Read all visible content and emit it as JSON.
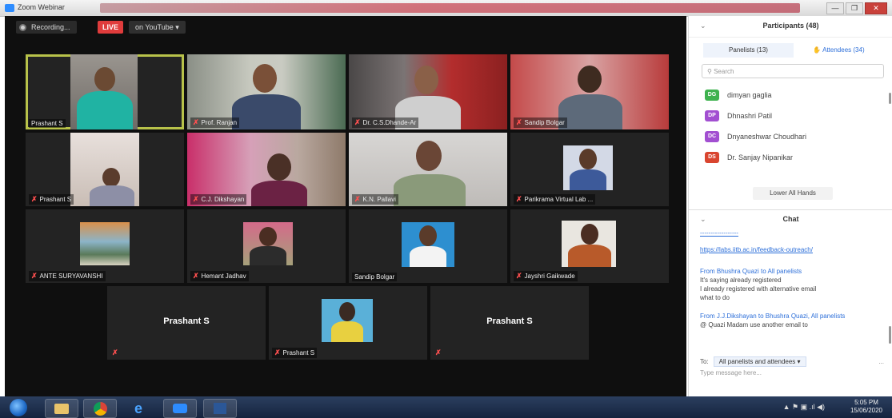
{
  "window": {
    "title": "Zoom Webinar",
    "controls": [
      "—",
      "❐",
      "✕"
    ]
  },
  "toolbar": {
    "recording": "Recording...",
    "live": "LIVE",
    "on_youtube": "on YouTube ▾"
  },
  "tiles": [
    {
      "name": "Prashant S",
      "mic_muted": false,
      "active": true
    },
    {
      "name": "Prof. Ranjan",
      "mic_muted": true
    },
    {
      "name": "Dr. C.S.Dhande-Ar",
      "mic_muted": true
    },
    {
      "name": "Sandip Bolgar",
      "mic_muted": true
    },
    {
      "name": "Prashant S",
      "mic_muted": true
    },
    {
      "name": "C.J. Dikshayan",
      "mic_muted": true
    },
    {
      "name": "K.N. Pallavi",
      "mic_muted": true
    },
    {
      "name": "Parikrama Virtual Lab ...",
      "mic_muted": true
    },
    {
      "name": "ANTE SURYAVANSHI",
      "mic_muted": true
    },
    {
      "name": "Hemant Jadhav",
      "mic_muted": true
    },
    {
      "name": "Sandip Bolgar",
      "mic_muted": false
    },
    {
      "name": "Jayshri Gaikwade",
      "mic_muted": true
    },
    {
      "name": "Prashant S",
      "mic_muted": true
    },
    {
      "name": "Prashant S",
      "mic_muted": true
    },
    {
      "name": "Prashant S",
      "mic_muted": true
    }
  ],
  "participants": {
    "title": "Participants (48)",
    "tab_panelists": "Panelists (13)",
    "tab_attendees": "Attendees (34)",
    "search_placeholder": "Search",
    "list": [
      {
        "initials": "DG",
        "name": "dimyan gaglia",
        "color": "#3fb24f"
      },
      {
        "initials": "DP",
        "name": "Dhnashri Patil",
        "color": "#a24fd1"
      },
      {
        "initials": "DC",
        "name": "Dnyaneshwar Choudhari",
        "color": "#a24fd1"
      },
      {
        "initials": "DS",
        "name": "Dr. Sanjay Nipanikar",
        "color": "#d9452f"
      }
    ],
    "lower_all_hands": "Lower All Hands"
  },
  "chat": {
    "title": "Chat",
    "link_partial": "------------------",
    "link": "https://labs.iitb.ac.in/feedback-outreach/",
    "msg1_from": "From Bhushra Quazi to All panelists",
    "msg1_lines": [
      "It's saying already registered",
      "I already registered with alternative email",
      "what to do"
    ],
    "msg2_from": "From J.J.Dikshayan to Bhushra Quazi, All panelists",
    "msg2_lines": [
      "@ Quazi Madam use another email to"
    ],
    "to_label": "To:",
    "to_value": "All panelists and attendees ▾",
    "more": "...",
    "placeholder": "Type message here..."
  },
  "taskbar": {
    "tray": "▲ ⚑ ▣ .ıl ◀)",
    "time": "5:05 PM",
    "date": "15/06/2020"
  },
  "colors": {
    "accent": "#2d8cff",
    "live": "#e03c3c",
    "active_outline": "#b8c24a"
  }
}
